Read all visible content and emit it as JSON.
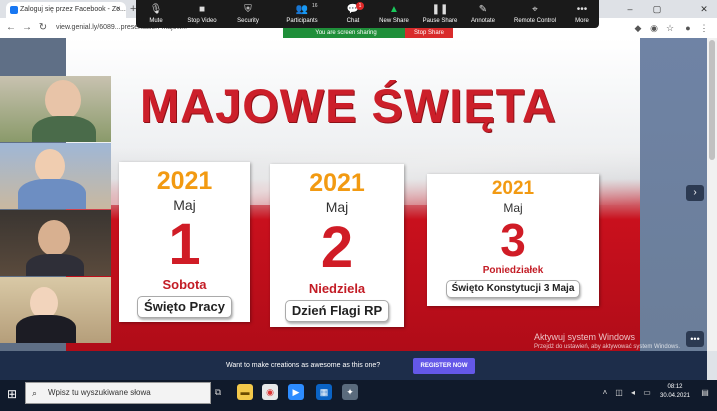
{
  "browser": {
    "tab_title": "Zaloguj się przez Facebook - Zo...",
    "tab_close": "×",
    "new_tab": "+",
    "url": "view.genial.ly/6089...presentation-majow...",
    "window_buttons": [
      "–",
      "▢",
      "✕"
    ]
  },
  "zoom_toolbar": {
    "buttons": [
      {
        "label": "Mute",
        "icon": "microphone-icon"
      },
      {
        "label": "Stop Video",
        "icon": "video-camera-icon"
      },
      {
        "label": "Security",
        "icon": "shield-icon"
      },
      {
        "label": "Participants",
        "icon": "participants-icon",
        "count": "16"
      },
      {
        "label": "Chat",
        "icon": "chat-icon",
        "badge": "1"
      },
      {
        "label": "New Share",
        "icon": "share-screen-icon",
        "color": "#19c95b"
      },
      {
        "label": "Pause Share",
        "icon": "pause-icon"
      },
      {
        "label": "Annotate",
        "icon": "pencil-icon"
      },
      {
        "label": "Remote Control",
        "icon": "remote-control-icon"
      },
      {
        "label": "More",
        "icon": "more-icon"
      }
    ],
    "sharing_status": "You are screen sharing",
    "stop_share": "Stop Share"
  },
  "slide": {
    "title": "MAJOWE ŚWIĘTA",
    "title_color": "#cc1f2a",
    "cards": [
      {
        "year": "2021",
        "month": "Maj",
        "day": "1",
        "weekday": "Sobota",
        "holiday": "Święto Pracy"
      },
      {
        "year": "2021",
        "month": "Maj",
        "day": "2",
        "weekday": "Niedziela",
        "holiday": "Dzień Flagi RP"
      },
      {
        "year": "2021",
        "month": "Maj",
        "day": "3",
        "weekday": "Poniedziałek",
        "holiday": "Święto Konstytucji 3 Maja"
      }
    ]
  },
  "register_bar": {
    "text": "Want to make creations as awesome as this one?",
    "button": "REGISTER NOW",
    "button_color": "#6458e8"
  },
  "windows_activation": {
    "title": "Aktywuj system Windows",
    "subtitle": "Przejdź do ustawień, aby aktywować system Windows."
  },
  "taskbar": {
    "search_placeholder": "Wpisz tu wyszukiwane słowa",
    "time": "08:12",
    "date": "30.04.2021"
  }
}
